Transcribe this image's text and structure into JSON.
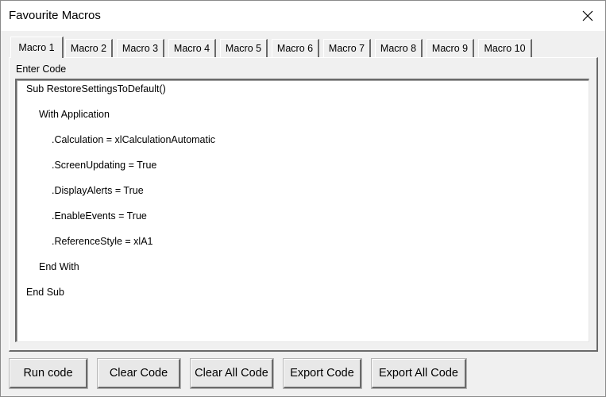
{
  "window": {
    "title": "Favourite Macros"
  },
  "tabs": [
    {
      "label": "Macro 1",
      "active": true
    },
    {
      "label": "Macro 2",
      "active": false
    },
    {
      "label": "Macro 3",
      "active": false
    },
    {
      "label": "Macro 4",
      "active": false
    },
    {
      "label": "Macro 5",
      "active": false
    },
    {
      "label": "Macro 6",
      "active": false
    },
    {
      "label": "Macro 7",
      "active": false
    },
    {
      "label": "Macro 8",
      "active": false
    },
    {
      "label": "Macro 9",
      "active": false
    },
    {
      "label": "Macro 10",
      "active": false
    }
  ],
  "panel": {
    "label": "Enter Code",
    "code_lines": [
      "Sub RestoreSettingsToDefault()",
      "With Application",
      ".Calculation = xlCalculationAutomatic",
      ".ScreenUpdating = True",
      ".DisplayAlerts = True",
      ".EnableEvents = True",
      ".ReferenceStyle = xlA1",
      "End With",
      "End Sub"
    ]
  },
  "buttons": {
    "run": "Run code",
    "clear": "Clear Code",
    "clear_all": "Clear All Code",
    "export": "Export Code",
    "export_all": "Export All Code"
  },
  "icons": {
    "close": "close-icon"
  }
}
